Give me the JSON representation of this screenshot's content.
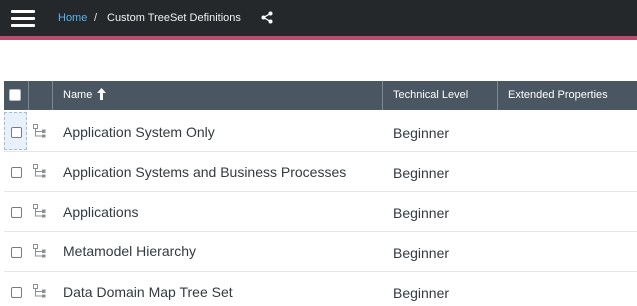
{
  "breadcrumb": {
    "home": "Home",
    "separator": "/",
    "current": "Custom TreeSet Definitions"
  },
  "icons": {
    "menu": "hamburger-menu-icon",
    "share": "share-icon",
    "sort": "sort-ascending-arrow-icon",
    "row": "tree-hierarchy-icon"
  },
  "colors": {
    "topbar": "#24282b",
    "accent_line": "#c04a6e",
    "link": "#5ab4f0",
    "table_header": "#4a5662"
  },
  "table": {
    "columns": {
      "name": "Name",
      "technical_level": "Technical Level",
      "extended_properties": "Extended Properties"
    },
    "rows": [
      {
        "name": "Application System Only",
        "technical_level": "Beginner",
        "extended_properties": ""
      },
      {
        "name": "Application Systems and Business Processes",
        "technical_level": "Beginner",
        "extended_properties": ""
      },
      {
        "name": "Applications",
        "technical_level": "Beginner",
        "extended_properties": ""
      },
      {
        "name": "Metamodel Hierarchy",
        "technical_level": "Beginner",
        "extended_properties": ""
      },
      {
        "name": "Data Domain Map Tree Set",
        "technical_level": "Beginner",
        "extended_properties": ""
      }
    ]
  }
}
